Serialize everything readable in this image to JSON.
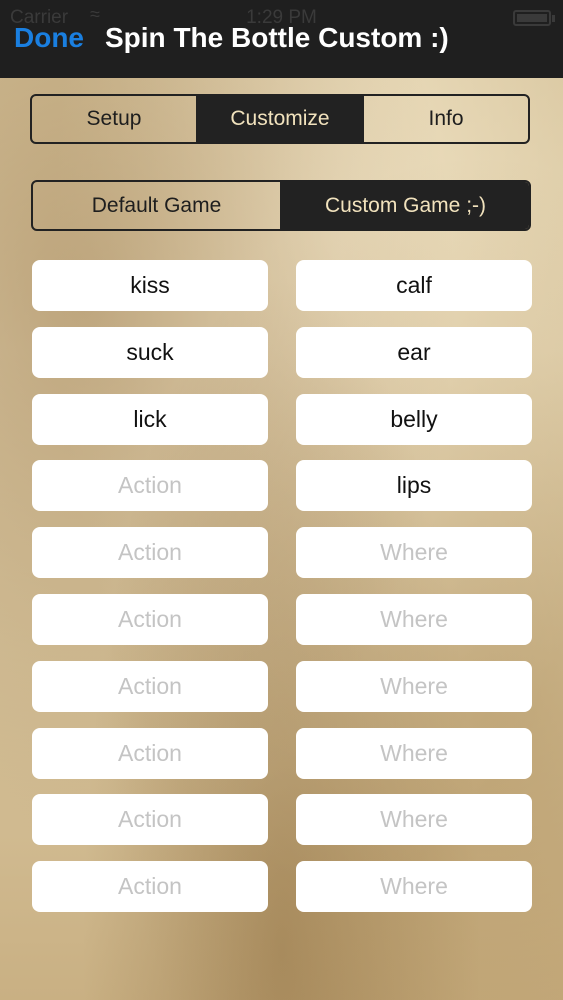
{
  "status_bar": {
    "carrier": "Carrier",
    "time": "1:29 PM"
  },
  "nav": {
    "done_label": "Done",
    "title": "Spin The Bottle Custom :)"
  },
  "main_tabs": [
    {
      "label": "Setup",
      "active": false
    },
    {
      "label": "Customize",
      "active": true
    },
    {
      "label": "Info",
      "active": false
    }
  ],
  "game_mode": [
    {
      "label": "Default Game",
      "active": false
    },
    {
      "label": "Custom Game ;-)",
      "active": true
    }
  ],
  "actions": {
    "placeholder": "Action",
    "values": [
      "kiss",
      "suck",
      "lick",
      "",
      "",
      "",
      "",
      "",
      "",
      ""
    ]
  },
  "wheres": {
    "placeholder": "Where",
    "values": [
      "calf",
      "ear",
      "belly",
      "lips",
      "",
      "",
      "",
      "",
      "",
      ""
    ]
  },
  "colors": {
    "accent": "#1a7fe0",
    "bar": "#1f1f1f",
    "active_segment": "#222222",
    "active_segment_text": "#f1e2bd"
  }
}
